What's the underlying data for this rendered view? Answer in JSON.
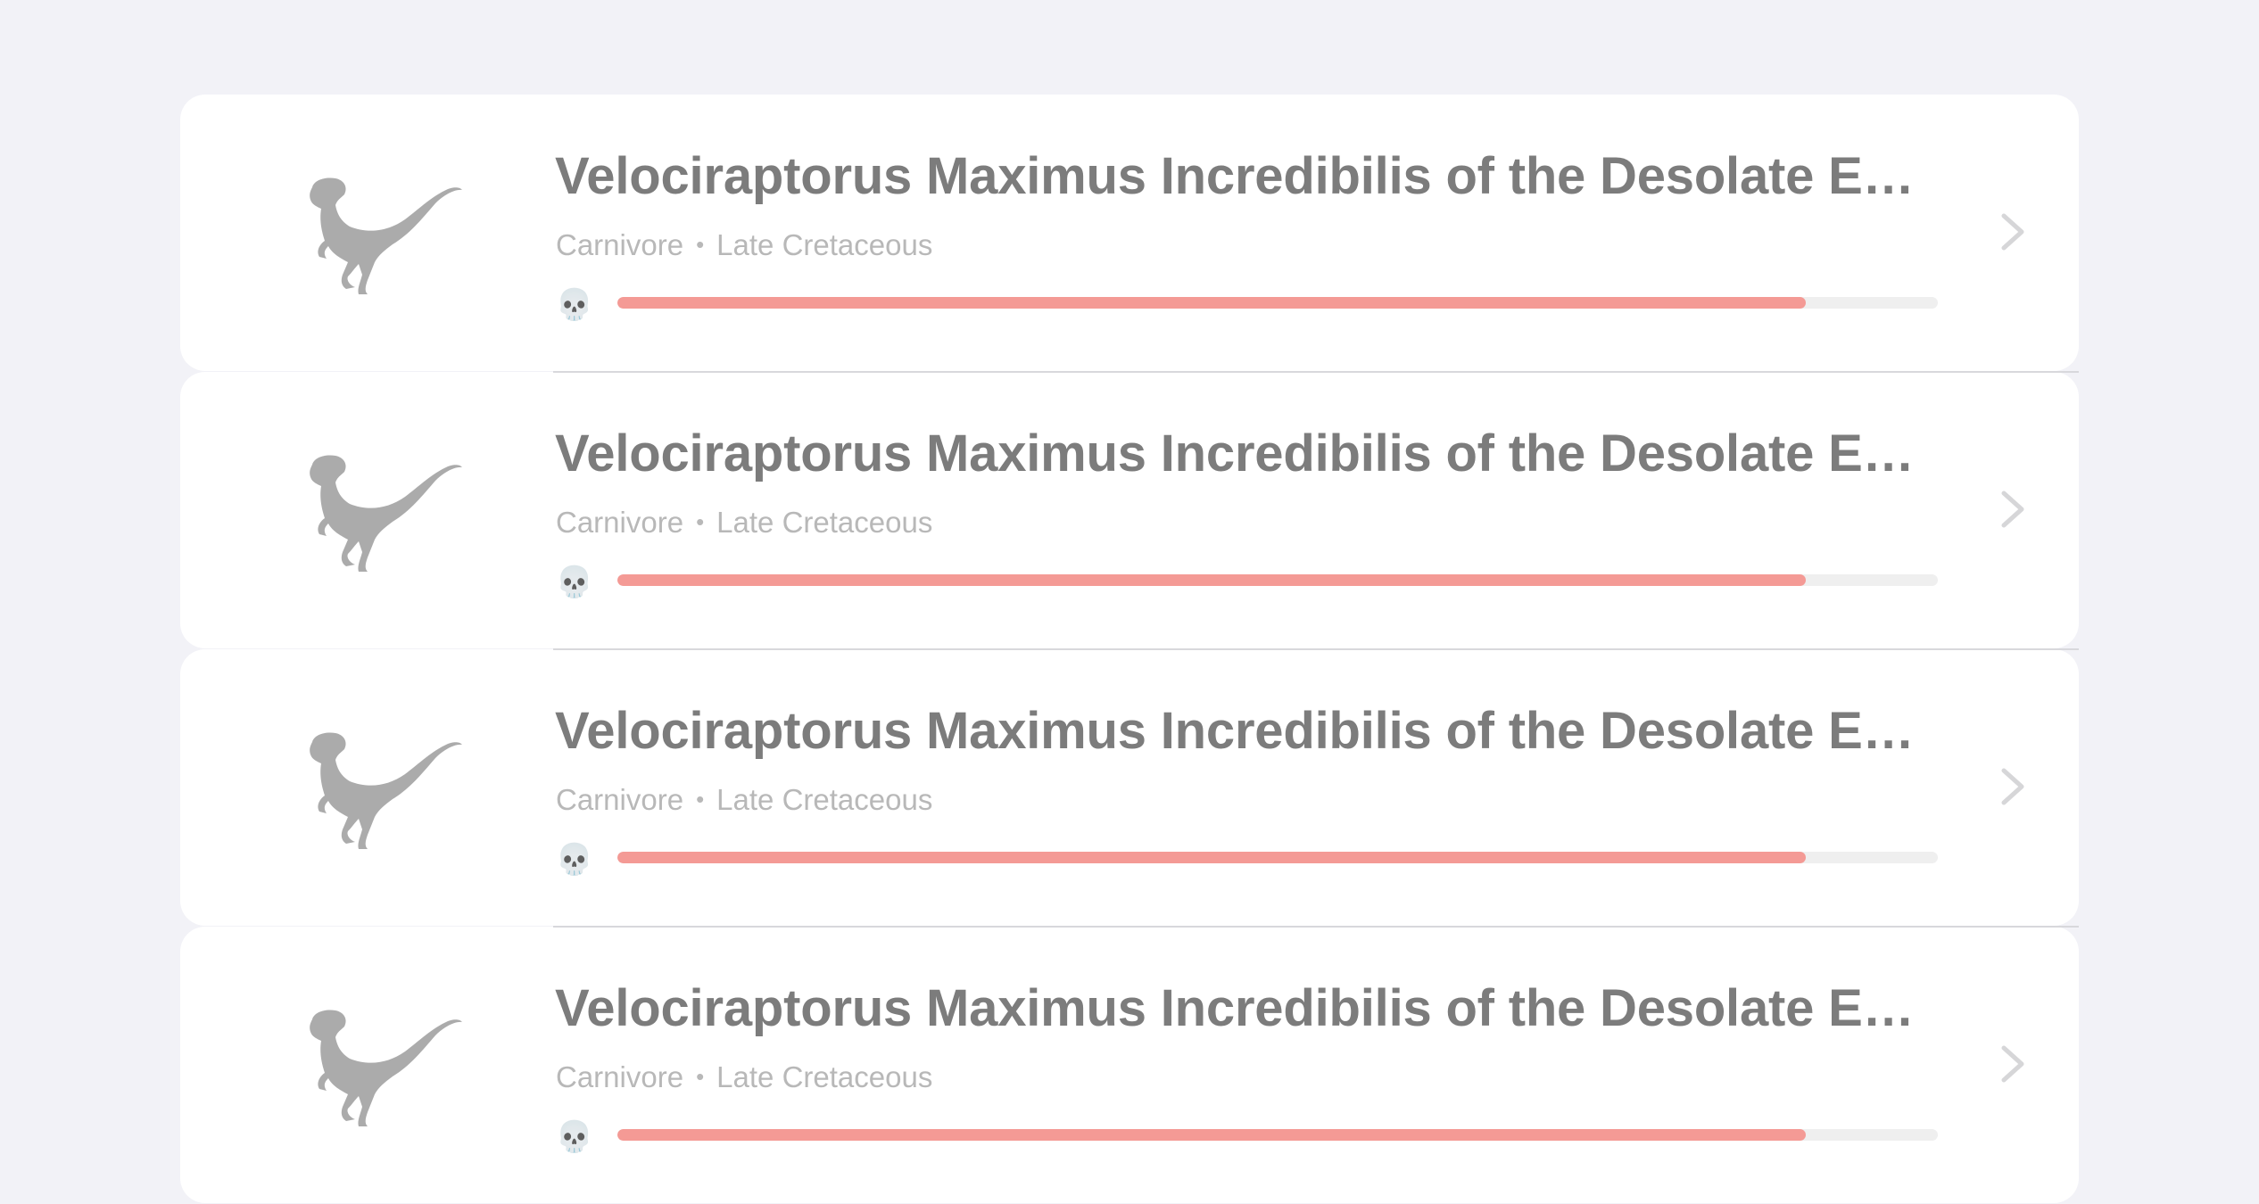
{
  "colors": {
    "background": "#f2f2f7",
    "card": "#ffffff",
    "title": "#7c7c7c",
    "subtitle": "#b8b8b8",
    "bar_fill": "#f49a95",
    "bar_track": "#efefef",
    "icon": "#ababab"
  },
  "rows": [
    {
      "icon": "velociraptor-icon",
      "title": "Velociraptorus Maximus Incredibilis of the Desolate East Plains",
      "diet": "Carnivore",
      "separator": "•",
      "period": "Late Cretaceous",
      "danger_icon": "skull-icon",
      "danger_glyph": "💀",
      "danger_level": 0.9
    },
    {
      "icon": "velociraptor-icon",
      "title": "Velociraptorus Maximus Incredibilis of the Desolate East Plains",
      "diet": "Carnivore",
      "separator": "•",
      "period": "Late Cretaceous",
      "danger_icon": "skull-icon",
      "danger_glyph": "💀",
      "danger_level": 0.9
    },
    {
      "icon": "velociraptor-icon",
      "title": "Velociraptorus Maximus Incredibilis of the Desolate East Plains",
      "diet": "Carnivore",
      "separator": "•",
      "period": "Late Cretaceous",
      "danger_icon": "skull-icon",
      "danger_glyph": "💀",
      "danger_level": 0.9
    },
    {
      "icon": "velociraptor-icon",
      "title": "Velociraptorus Maximus Incredibilis of the Desolate East Plains",
      "diet": "Carnivore",
      "separator": "•",
      "period": "Late Cretaceous",
      "danger_icon": "skull-icon",
      "danger_glyph": "💀",
      "danger_level": 0.9
    }
  ]
}
